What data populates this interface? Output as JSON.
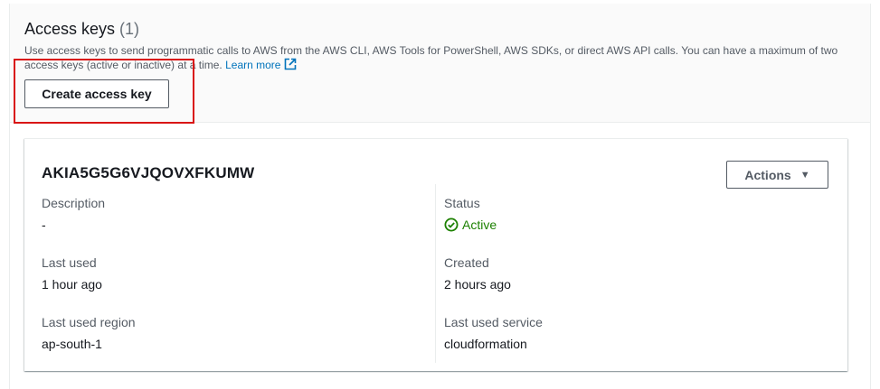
{
  "section": {
    "title": "Access keys",
    "count": "(1)",
    "description": "Use access keys to send programmatic calls to AWS from the AWS CLI, AWS Tools for PowerShell, AWS SDKs, or direct AWS API calls. You can have a maximum of two access keys (active or inactive) at a time.",
    "learn_more": "Learn more",
    "create_button": "Create access key"
  },
  "key": {
    "id": "AKIA5G5G6VJQOVXFKUMW",
    "actions_label": "Actions",
    "fields": {
      "description_label": "Description",
      "description_value": "-",
      "status_label": "Status",
      "status_value": "Active",
      "last_used_label": "Last used",
      "last_used_value": "1 hour ago",
      "created_label": "Created",
      "created_value": "2 hours ago",
      "last_used_region_label": "Last used region",
      "last_used_region_value": "ap-south-1",
      "last_used_service_label": "Last used service",
      "last_used_service_value": "cloudformation"
    }
  },
  "colors": {
    "link": "#0073bb",
    "active": "#1d8102",
    "highlight": "#d91515"
  }
}
